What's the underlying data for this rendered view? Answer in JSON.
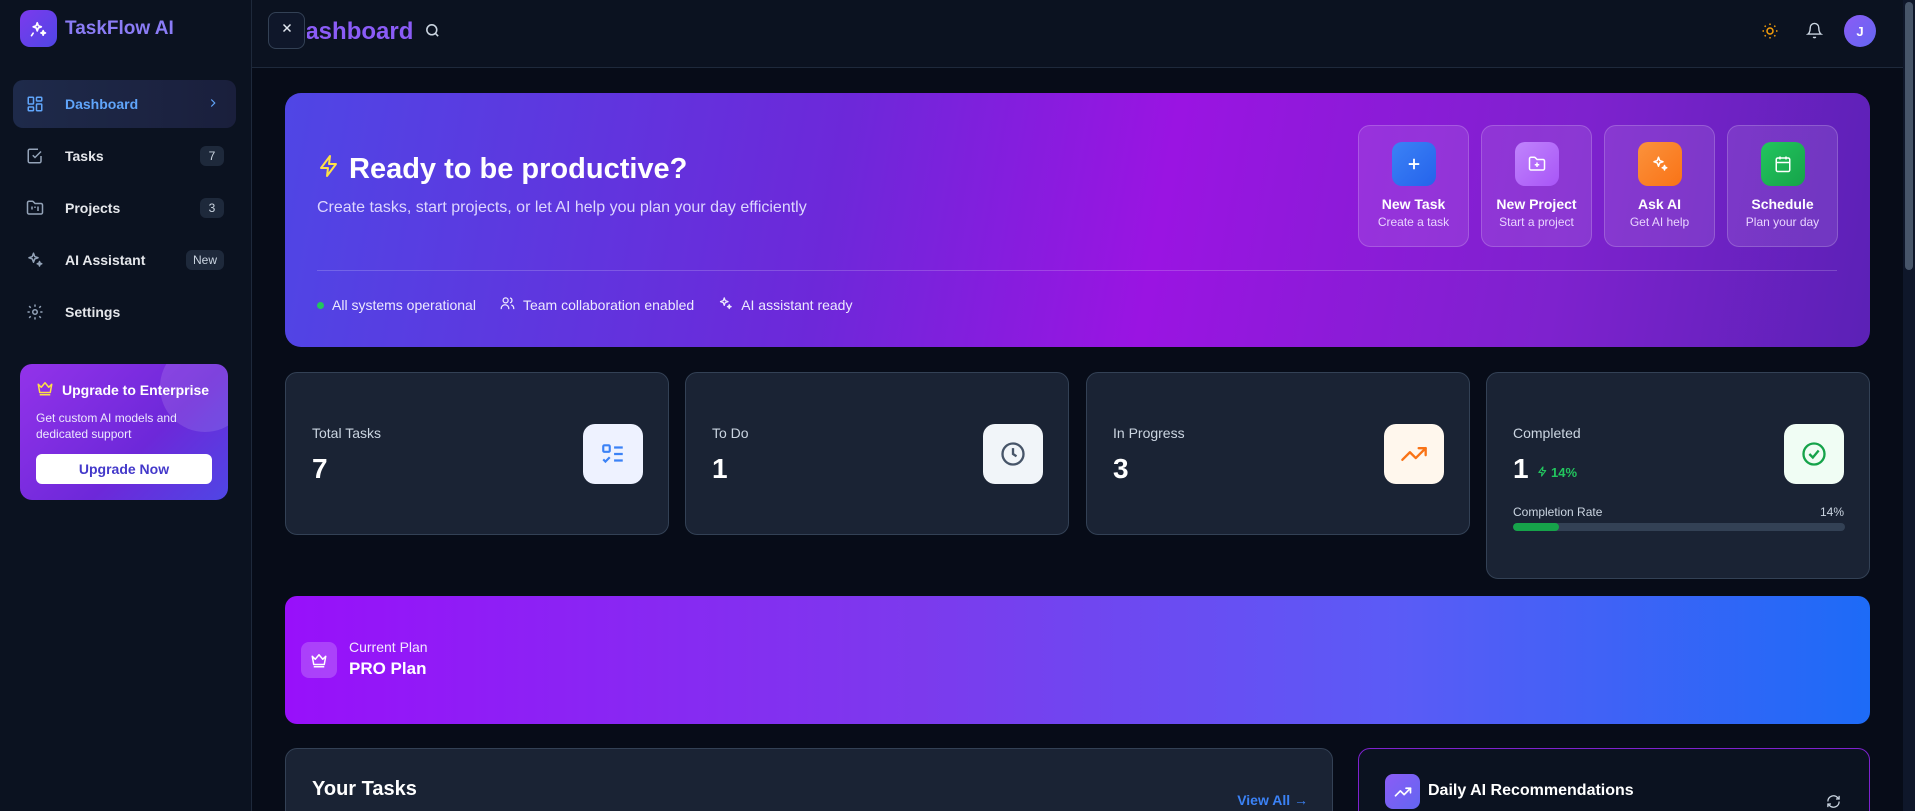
{
  "brand": {
    "name": "TaskFlow AI"
  },
  "header": {
    "title": "Dashboard",
    "avatar_initial": "J"
  },
  "sidebar": {
    "items": [
      {
        "label": "Dashboard",
        "badge": ""
      },
      {
        "label": "Tasks",
        "badge": "7"
      },
      {
        "label": "Projects",
        "badge": "3"
      },
      {
        "label": "AI Assistant",
        "badge": "New"
      },
      {
        "label": "Settings",
        "badge": ""
      }
    ],
    "upgrade": {
      "title": "Upgrade to Enterprise",
      "description": "Get custom AI models and dedicated support",
      "button": "Upgrade Now"
    }
  },
  "hero": {
    "title": "Ready to be productive?",
    "subtitle": "Create tasks, start projects, or let AI help you plan your day efficiently",
    "actions": [
      {
        "name": "New Task",
        "desc": "Create a task",
        "color": "#2563eb",
        "icon": "plus-icon"
      },
      {
        "name": "New Project",
        "desc": "Start a project",
        "color": "#a855f7",
        "icon": "folder-plus-icon"
      },
      {
        "name": "Ask AI",
        "desc": "Get AI help",
        "color": "#f97316",
        "icon": "sparkles-icon"
      },
      {
        "name": "Schedule",
        "desc": "Plan your day",
        "color": "#16a34a",
        "icon": "calendar-icon"
      }
    ],
    "status": [
      "All systems operational",
      "Team collaboration enabled",
      "AI assistant ready"
    ]
  },
  "stats": [
    {
      "label": "Total Tasks",
      "value": "7",
      "icon": "list-check-icon",
      "icon_bg": "#eef2ff",
      "icon_color": "#3b82f6"
    },
    {
      "label": "To Do",
      "value": "1",
      "icon": "clock-icon",
      "icon_bg": "#f1f5f9",
      "icon_color": "#475569"
    },
    {
      "label": "In Progress",
      "value": "3",
      "icon": "trending-up-icon",
      "icon_bg": "#fff7ed",
      "icon_color": "#f97316"
    },
    {
      "label": "Completed",
      "value": "1",
      "trend": "14%",
      "rate_label": "Completion Rate",
      "rate_value": "14%",
      "rate_fraction": 0.14,
      "icon": "check-circle-icon",
      "icon_bg": "#f0fdf4",
      "icon_color": "#16a34a"
    }
  ],
  "plan": {
    "label": "Current Plan",
    "name": "PRO Plan"
  },
  "tasks_panel": {
    "title": "Your Tasks",
    "view_all": "View All →"
  },
  "recommendations": {
    "title": "Daily AI Recommendations"
  },
  "colors": {
    "accent": "#8b5cf6",
    "active_nav": "#60a5fa",
    "success": "#22c55e"
  }
}
